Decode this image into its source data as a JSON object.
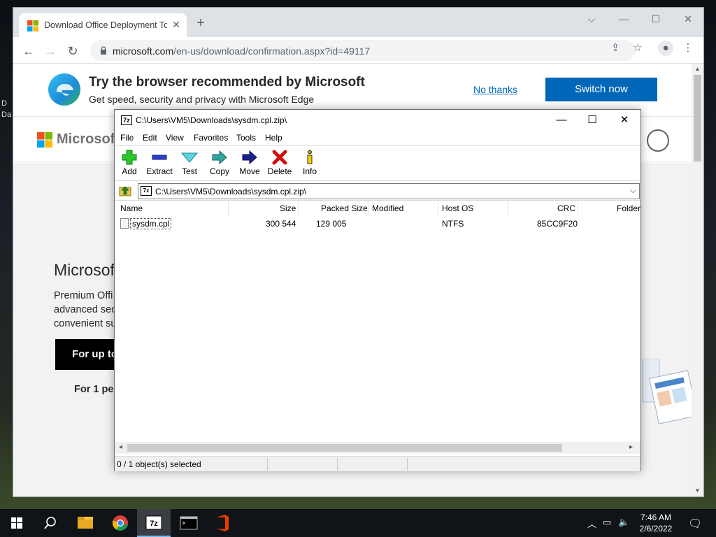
{
  "desktop": {
    "fragment_a": "D",
    "fragment_b": "Da"
  },
  "browser": {
    "tab_title": "Download Office Deployment To",
    "tab_close": "✕",
    "new_tab": "+",
    "url_host": "microsoft.com",
    "url_path": "/en-us/download/confirmation.aspx?id=49117",
    "window_controls": {
      "menu": "⌵",
      "minimize": "—",
      "maximize": "☐",
      "close": "✕"
    }
  },
  "edge_promo": {
    "title": "Try the browser recommended by Microsoft",
    "subtitle": "Get speed, security and privacy with Microsoft Edge",
    "no_thanks": "No thanks",
    "switch_now": "Switch now"
  },
  "ms_site": {
    "logo_text": "Microsoft",
    "hero_title": "Microsoft",
    "hero_body_1": "Premium Offi",
    "hero_body_2": "advanced sec",
    "hero_body_3": "convenient su",
    "hero_cta": "For up to",
    "hero_for1": "For 1 per"
  },
  "sevenzip": {
    "app_icon": "7z",
    "title": "C:\\Users\\VM5\\Downloads\\sysdm.cpl.zip\\",
    "controls": {
      "minimize": "—",
      "maximize": "☐",
      "close": "✕"
    },
    "menu": [
      "File",
      "Edit",
      "View",
      "Favorites",
      "Tools",
      "Help"
    ],
    "toolbar": [
      "Add",
      "Extract",
      "Test",
      "Copy",
      "Move",
      "Delete",
      "Info"
    ],
    "address": "C:\\Users\\VM5\\Downloads\\sysdm.cpl.zip\\",
    "columns": [
      "Name",
      "Size",
      "Packed Size",
      "Modified",
      "Host OS",
      "CRC",
      "Folder"
    ],
    "rows": [
      {
        "name": "sysdm.cpl",
        "size": "300 544",
        "packed": "129 005",
        "modified": "",
        "host_os": "NTFS",
        "crc": "85CC9F20",
        "folders": ""
      }
    ],
    "status": "0 / 1 object(s) selected"
  },
  "taskbar": {
    "time": "7:46 AM",
    "date": "2/6/2022",
    "active_app": "7-Zip",
    "zip_label": "7z"
  },
  "colors": {
    "accent": "#0067b8",
    "taskbar": "#101317"
  }
}
